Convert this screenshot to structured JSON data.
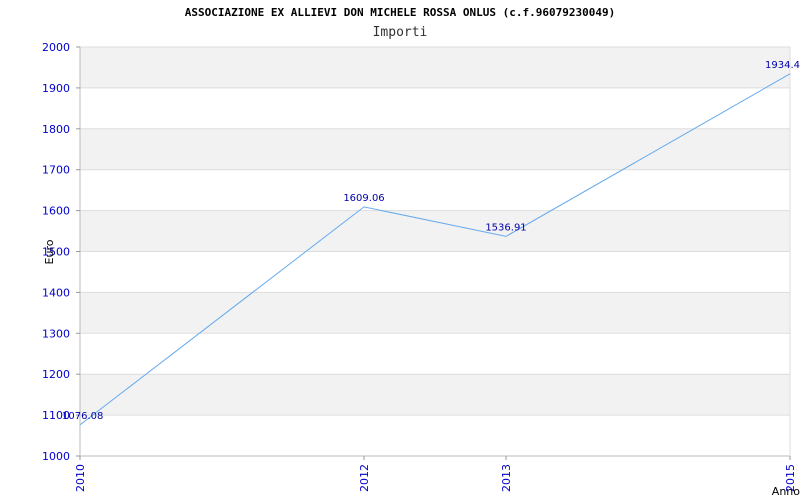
{
  "header": {
    "title": "ASSOCIAZIONE EX ALLIEVI DON MICHELE ROSSA ONLUS (c.f.96079230049)",
    "subtitle": "Importi"
  },
  "chart_data": {
    "type": "line",
    "title": "ASSOCIAZIONE EX ALLIEVI DON MICHELE ROSSA ONLUS (c.f.96079230049)",
    "subtitle": "Importi",
    "xlabel": "Anno",
    "ylabel": "Euro",
    "categories": [
      "2010",
      "2012",
      "2013",
      "2015"
    ],
    "series": [
      {
        "values": [
          1076.08,
          1609.06,
          1536.91,
          1934.4
        ],
        "labels": [
          "1076.08",
          "1609.06",
          "1536.91",
          "1934.4"
        ]
      }
    ],
    "ylim": [
      1000,
      2000
    ],
    "yticks": [
      1000,
      1100,
      1200,
      1300,
      1400,
      1500,
      1600,
      1700,
      1800,
      1900,
      2000
    ],
    "grid": true,
    "colors": {
      "line": "#66aaee",
      "band": "#f2f2f2",
      "grid": "#dddddd",
      "tick_text": "#0000cc",
      "data_label": "#0000aa"
    }
  }
}
